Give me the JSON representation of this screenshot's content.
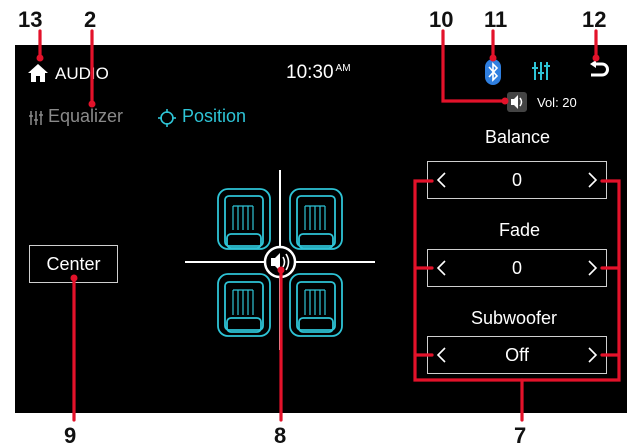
{
  "callouts": {
    "c13": "13",
    "c2": "2",
    "c10": "10",
    "c11": "11",
    "c12": "12",
    "c9": "9",
    "c8": "8",
    "c7": "7"
  },
  "header": {
    "title": "AUDIO",
    "time": "10:30",
    "ampm": "AM",
    "home_icon": "home-icon",
    "bluetooth_icon": "bluetooth-icon",
    "equalizer_icon": "equalizer-icon",
    "back_icon": "back-icon"
  },
  "volume": {
    "label": "Vol: 20",
    "icon": "speaker-icon"
  },
  "tabs": [
    {
      "label": "Equalizer",
      "icon": "equalizer-icon",
      "active": false
    },
    {
      "label": "Position",
      "icon": "position-icon",
      "active": true
    }
  ],
  "center_button": {
    "label": "Center"
  },
  "controls": {
    "balance": {
      "title": "Balance",
      "value": "0"
    },
    "fade": {
      "title": "Fade",
      "value": "0"
    },
    "subwoofer": {
      "title": "Subwoofer",
      "value": "Off"
    }
  },
  "colors": {
    "background": "#000000",
    "accent_teal": "#2ec4d6",
    "callout_red": "#e3122a",
    "bluetooth": "#2f7fe0",
    "inactive_text": "#8a8a8a"
  }
}
